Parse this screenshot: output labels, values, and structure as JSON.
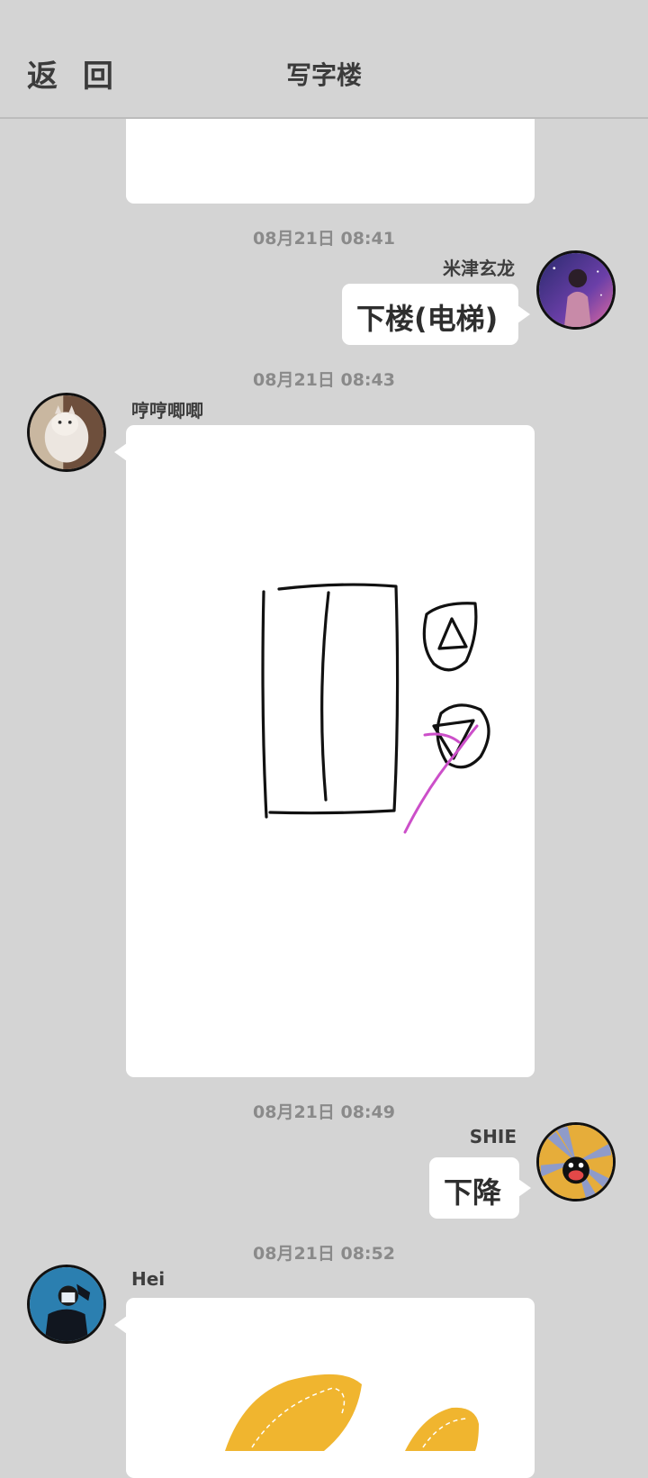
{
  "header": {
    "back_label": "返 回",
    "title": "写字楼"
  },
  "messages": [
    {
      "timestamp": "08月21日 08:41",
      "sender": "米津玄龙",
      "text": "下楼(电梯)"
    },
    {
      "timestamp": "08月21日 08:43",
      "sender": "哼哼唧唧",
      "image": "elevator-drawing"
    },
    {
      "timestamp": "08月21日 08:49",
      "sender": "SHIE",
      "text": "下降"
    },
    {
      "timestamp": "08月21日 08:52",
      "sender": "Hei",
      "image": "yellow-drawing"
    }
  ],
  "colors": {
    "background": "#d4d4d4",
    "bubble": "#ffffff",
    "accent_stroke": "#cc4fc9",
    "yellow": "#f0b52f"
  }
}
